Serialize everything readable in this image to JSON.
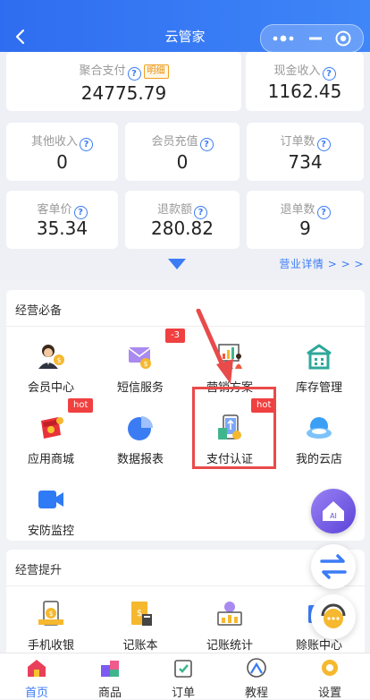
{
  "header": {
    "title": "云管家"
  },
  "stats": {
    "aggregate": {
      "label": "聚合支付",
      "tag": "明细",
      "value": "24775.79"
    },
    "cash": {
      "label": "现金收入",
      "value": "1162.45"
    },
    "other": {
      "label": "其他收入",
      "value": "0"
    },
    "recharge": {
      "label": "会员充值",
      "value": "0"
    },
    "orders": {
      "label": "订单数",
      "value": "734"
    },
    "per_customer": {
      "label": "客单价",
      "value": "35.34"
    },
    "refund_amount": {
      "label": "退款额",
      "value": "280.82"
    },
    "refund_orders": {
      "label": "退单数",
      "value": "9"
    },
    "detail_link": "营业详情 > > >"
  },
  "essentials": {
    "title": "经营必备",
    "items": [
      {
        "label": "会员中心",
        "icon": "member-center-icon"
      },
      {
        "label": "短信服务",
        "icon": "sms-icon",
        "badge": "-3"
      },
      {
        "label": "营销方案",
        "icon": "marketing-icon"
      },
      {
        "label": "库存管理",
        "icon": "inventory-icon"
      },
      {
        "label": "应用商城",
        "icon": "app-store-icon",
        "badge": "hot"
      },
      {
        "label": "数据报表",
        "icon": "pie-chart-icon"
      },
      {
        "label": "支付认证",
        "icon": "payment-auth-icon",
        "badge": "hot"
      },
      {
        "label": "我的云店",
        "icon": "cloud-store-icon"
      },
      {
        "label": "安防监控",
        "icon": "camera-icon"
      }
    ]
  },
  "improve": {
    "title": "经营提升",
    "items": [
      {
        "label": "手机收银",
        "icon": "mobile-cashier-icon"
      },
      {
        "label": "记账本",
        "icon": "ledger-icon"
      },
      {
        "label": "记账统计",
        "icon": "ledger-stats-icon"
      },
      {
        "label": "赊账中心",
        "icon": "credit-center-icon"
      }
    ]
  },
  "fabs": {
    "ai_label": "AI"
  },
  "tabbar": [
    {
      "label": "首页",
      "icon": "home-icon",
      "active": true
    },
    {
      "label": "商品",
      "icon": "goods-icon"
    },
    {
      "label": "订单",
      "icon": "order-icon"
    },
    {
      "label": "教程",
      "icon": "tutorial-icon"
    },
    {
      "label": "设置",
      "icon": "settings-icon"
    }
  ],
  "colors": {
    "primary": "#3b7cf5",
    "badge": "#f04040",
    "highlight": "#e94a4a"
  }
}
